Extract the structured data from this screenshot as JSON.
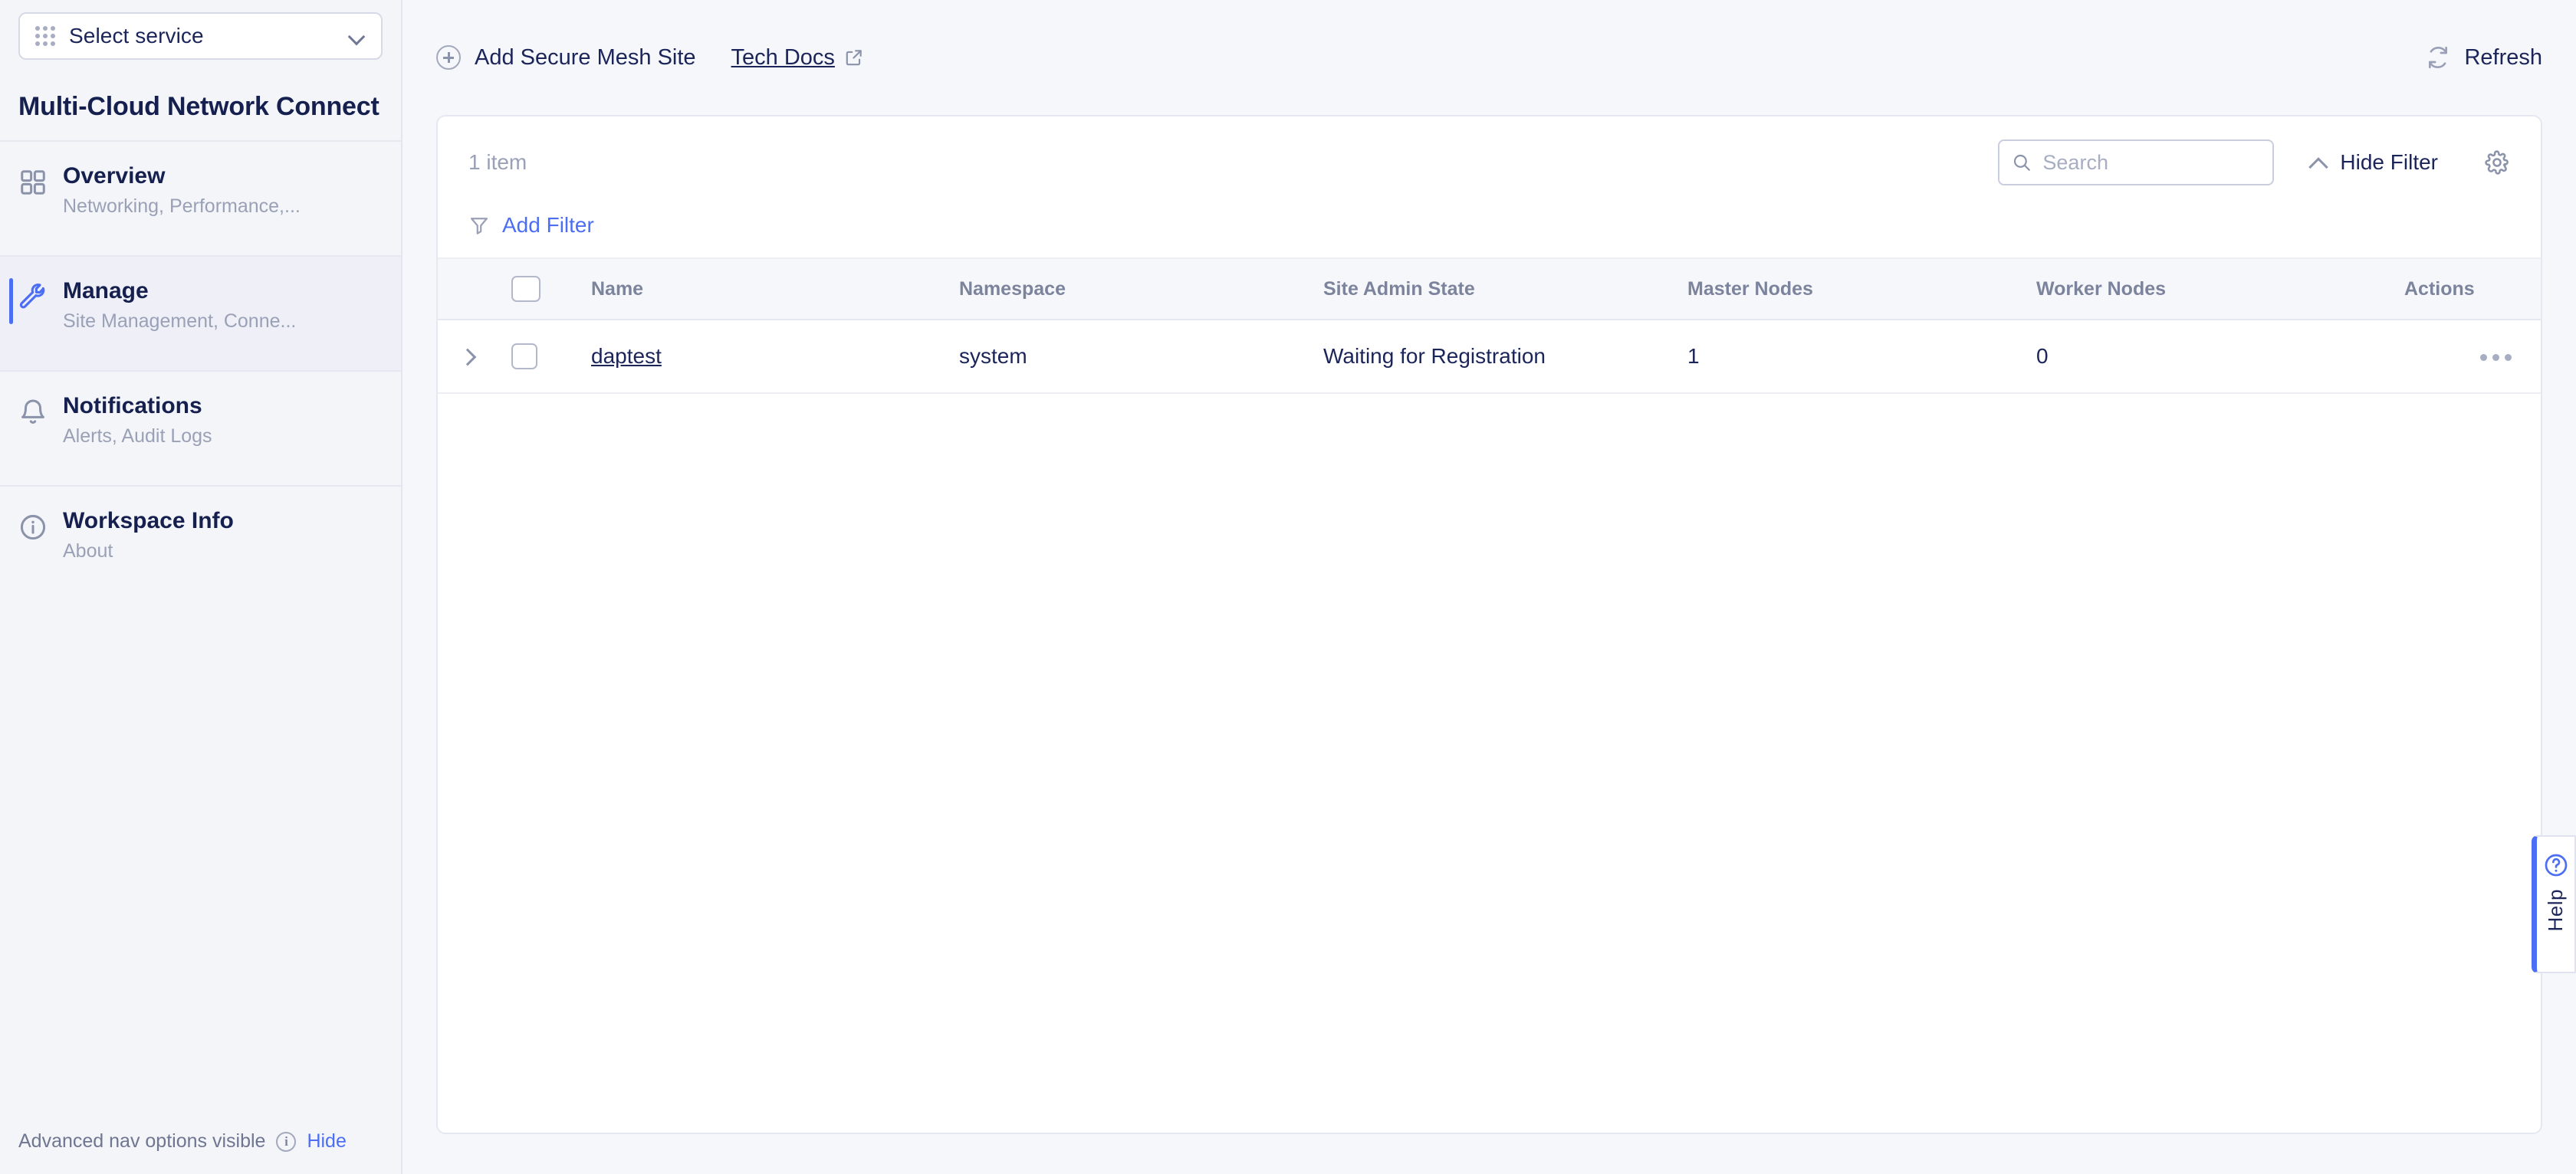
{
  "sidebar": {
    "service_select": {
      "label": "Select service",
      "icon": "apps-grid-icon",
      "chevron": "chevron-down-icon"
    },
    "product_title": "Multi-Cloud Network Connect",
    "items": [
      {
        "label": "Overview",
        "sublabel": "Networking, Performance,...",
        "icon": "dashboard-grid-icon",
        "active": false
      },
      {
        "label": "Manage",
        "sublabel": "Site Management, Conne...",
        "icon": "wrench-icon",
        "active": true
      },
      {
        "label": "Notifications",
        "sublabel": "Alerts, Audit Logs",
        "icon": "bell-icon",
        "active": false
      },
      {
        "label": "Workspace Info",
        "sublabel": "About",
        "icon": "info-circle-icon",
        "active": false
      }
    ],
    "footer": {
      "text": "Advanced nav options visible",
      "info_icon": "info-circle-icon",
      "hide_label": "Hide"
    }
  },
  "topbar": {
    "add_site_label": "Add Secure Mesh Site",
    "add_site_icon": "plus-circle-icon",
    "tech_docs_label": "Tech Docs",
    "tech_docs_icon": "external-link-icon",
    "refresh_label": "Refresh",
    "refresh_icon": "refresh-icon"
  },
  "card": {
    "item_count": "1 item",
    "search": {
      "placeholder": "Search",
      "value": "",
      "icon": "search-icon"
    },
    "hide_filter_label": "Hide Filter",
    "hide_filter_icon": "chevron-up-icon",
    "settings_icon": "gear-icon",
    "add_filter_label": "Add Filter",
    "add_filter_icon": "funnel-icon",
    "table": {
      "columns": [
        "Name",
        "Namespace",
        "Site Admin State",
        "Master Nodes",
        "Worker Nodes",
        "Actions"
      ],
      "rows": [
        {
          "name": "daptest",
          "namespace": "system",
          "site_admin_state": "Waiting for Registration",
          "master_nodes": "1",
          "worker_nodes": "0",
          "actions_icon": "kebab-menu-icon"
        }
      ]
    }
  },
  "help": {
    "label": "Help",
    "icon": "question-circle-icon"
  },
  "colors": {
    "accent": "#4c6ef5",
    "text_primary": "#1b2559",
    "text_muted": "#9aa1b7",
    "page_bg": "#f6f7fa",
    "sidebar_bg": "#f4f5f9",
    "card_bg": "#ffffff",
    "border": "#e6e8f1"
  }
}
